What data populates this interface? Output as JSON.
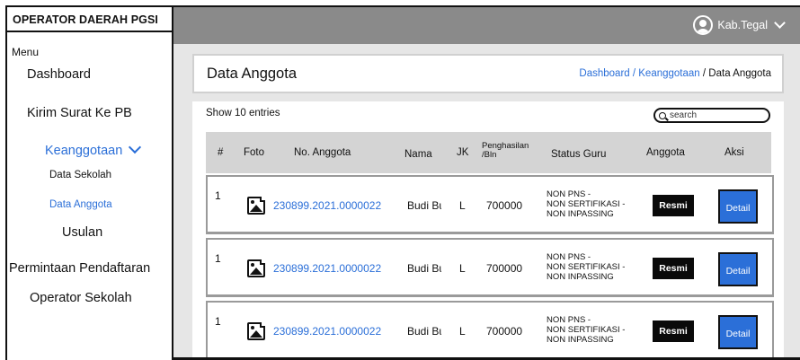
{
  "sidebar": {
    "brand": "OPERATOR DAERAH PGSI",
    "menu_label": "Menu",
    "items": {
      "dashboard": "Dashboard",
      "kirim_surat": "Kirim Surat Ke PB",
      "keanggotaan": "Keanggotaan",
      "data_sekolah": "Data Sekolah",
      "data_anggota": "Data Anggota",
      "usulan": "Usulan",
      "permintaan": "Permintaan Pendaftaran",
      "operator_sekolah": "Operator Sekolah"
    }
  },
  "topbar": {
    "user_name": "Kab.Tegal"
  },
  "page": {
    "title": "Data Anggota",
    "breadcrumb": {
      "dashboard": "Dashboard",
      "sep1": " / ",
      "keanggotaan": "Keanggotaan",
      "sep2": " / ",
      "current": "Data Anggota"
    }
  },
  "table": {
    "show_entries": "Show 10 entries",
    "search_placeholder": "search",
    "headers": {
      "num": "#",
      "foto": "Foto",
      "no_anggota": "No. Anggota",
      "nama": "Nama",
      "jk": "JK",
      "penghasilan": "Penghasilan\n/Bln",
      "status": "Status Guru",
      "anggota": "Anggota",
      "aksi": "Aksi"
    },
    "rows": [
      {
        "num": "1",
        "no_anggota": "230899.2021.0000022",
        "nama": "Budi Bu",
        "jk": "L",
        "penghasilan": "700000",
        "status": "NON PNS -\nNON SERTIFIKASI -\nNON INPASSING",
        "anggota": "Resmi",
        "aksi": "Detail"
      },
      {
        "num": "1",
        "no_anggota": "230899.2021.0000022",
        "nama": "Budi Bu",
        "jk": "L",
        "penghasilan": "700000",
        "status": "NON PNS -\nNON SERTIFIKASI -\nNON INPASSING",
        "anggota": "Resmi",
        "aksi": "Detail"
      },
      {
        "num": "1",
        "no_anggota": "230899.2021.0000022",
        "nama": "Budi Bu",
        "jk": "L",
        "penghasilan": "700000",
        "status": "NON PNS -\nNON SERTIFIKASI -\nNON INPASSING",
        "anggota": "Resmi",
        "aksi": "Detail"
      }
    ]
  },
  "colors": {
    "accent": "#2b6fd8",
    "topbar": "#8a8a8a",
    "content_bg": "#e6e6e6",
    "badge": "#0a0a0a"
  }
}
